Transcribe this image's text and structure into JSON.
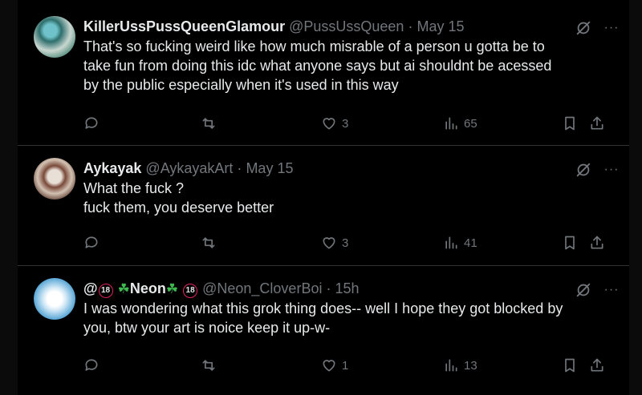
{
  "tweets": [
    {
      "name": "KillerUssPussQueenGlamour",
      "handle": "@PussUssQueen",
      "dot": "·",
      "time": "May 15",
      "lines": [
        "That's so fucking weird like how much misrable of a person u gotta be to",
        "take fun from doing this idc what anyone says but ai shouldnt be acessed",
        "by the public especially when it's used in this way"
      ],
      "likes": "3",
      "views": "65"
    },
    {
      "name": "Aykayak",
      "handle": "@AykayakArt",
      "dot": "·",
      "time": "May 15",
      "lines": [
        "What the fuck ?",
        "fuck them, you deserve better"
      ],
      "likes": "3",
      "views": "41"
    },
    {
      "name_prefix": "@",
      "badge": "18",
      "name": "Neon",
      "handle": "@Neon_CloverBoi",
      "dot": "·",
      "time": "15h",
      "lines": [
        "I was wondering what this grok thing does-- well I hope they got blocked by",
        "you, btw your art is noice keep it up-w-"
      ],
      "likes": "1",
      "views": "13"
    }
  ],
  "more_label": "···",
  "clover_glyph": "☘",
  "icons": {
    "reply": "reply-icon",
    "retweet": "retweet-icon",
    "like": "heart-icon",
    "views": "views-chart-icon",
    "bookmark": "bookmark-icon",
    "share": "share-icon",
    "grok": "grok-icon",
    "more": "more-icon"
  },
  "colors": {
    "background": "#000000",
    "text": "#e7e9ea",
    "muted": "#71767b",
    "divider": "#2f3336"
  }
}
